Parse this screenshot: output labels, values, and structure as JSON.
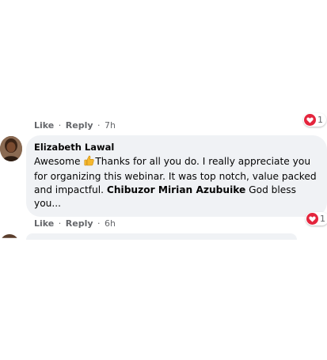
{
  "comment_above": {
    "like_label": "Like",
    "separator": "·",
    "reply_label": "Reply",
    "time": "7h",
    "reaction_count": "1",
    "reaction_icon": "heart-icon",
    "reaction_color": "#e4253d"
  },
  "comment": {
    "author": "Elizabeth Lawal",
    "text_part1": "Awesome ",
    "emoji_icon": "thumbs-up-icon",
    "text_part2": "Thanks for all you do. I really appreciate you for organizing this webinar. It was top notch, value packed and impactful. ",
    "mention": "Chibuzor Mirian Azubuike",
    "text_part3": " God bless you...",
    "like_label": "Like",
    "separator": "·",
    "reply_label": "Reply",
    "time": "6h",
    "reaction_count": "1",
    "reaction_icon": "heart-icon",
    "reaction_color": "#e4253d"
  },
  "colors": {
    "bubble_bg": "#f0f2f5",
    "meta_text": "#65676b",
    "body_text": "#050505"
  }
}
